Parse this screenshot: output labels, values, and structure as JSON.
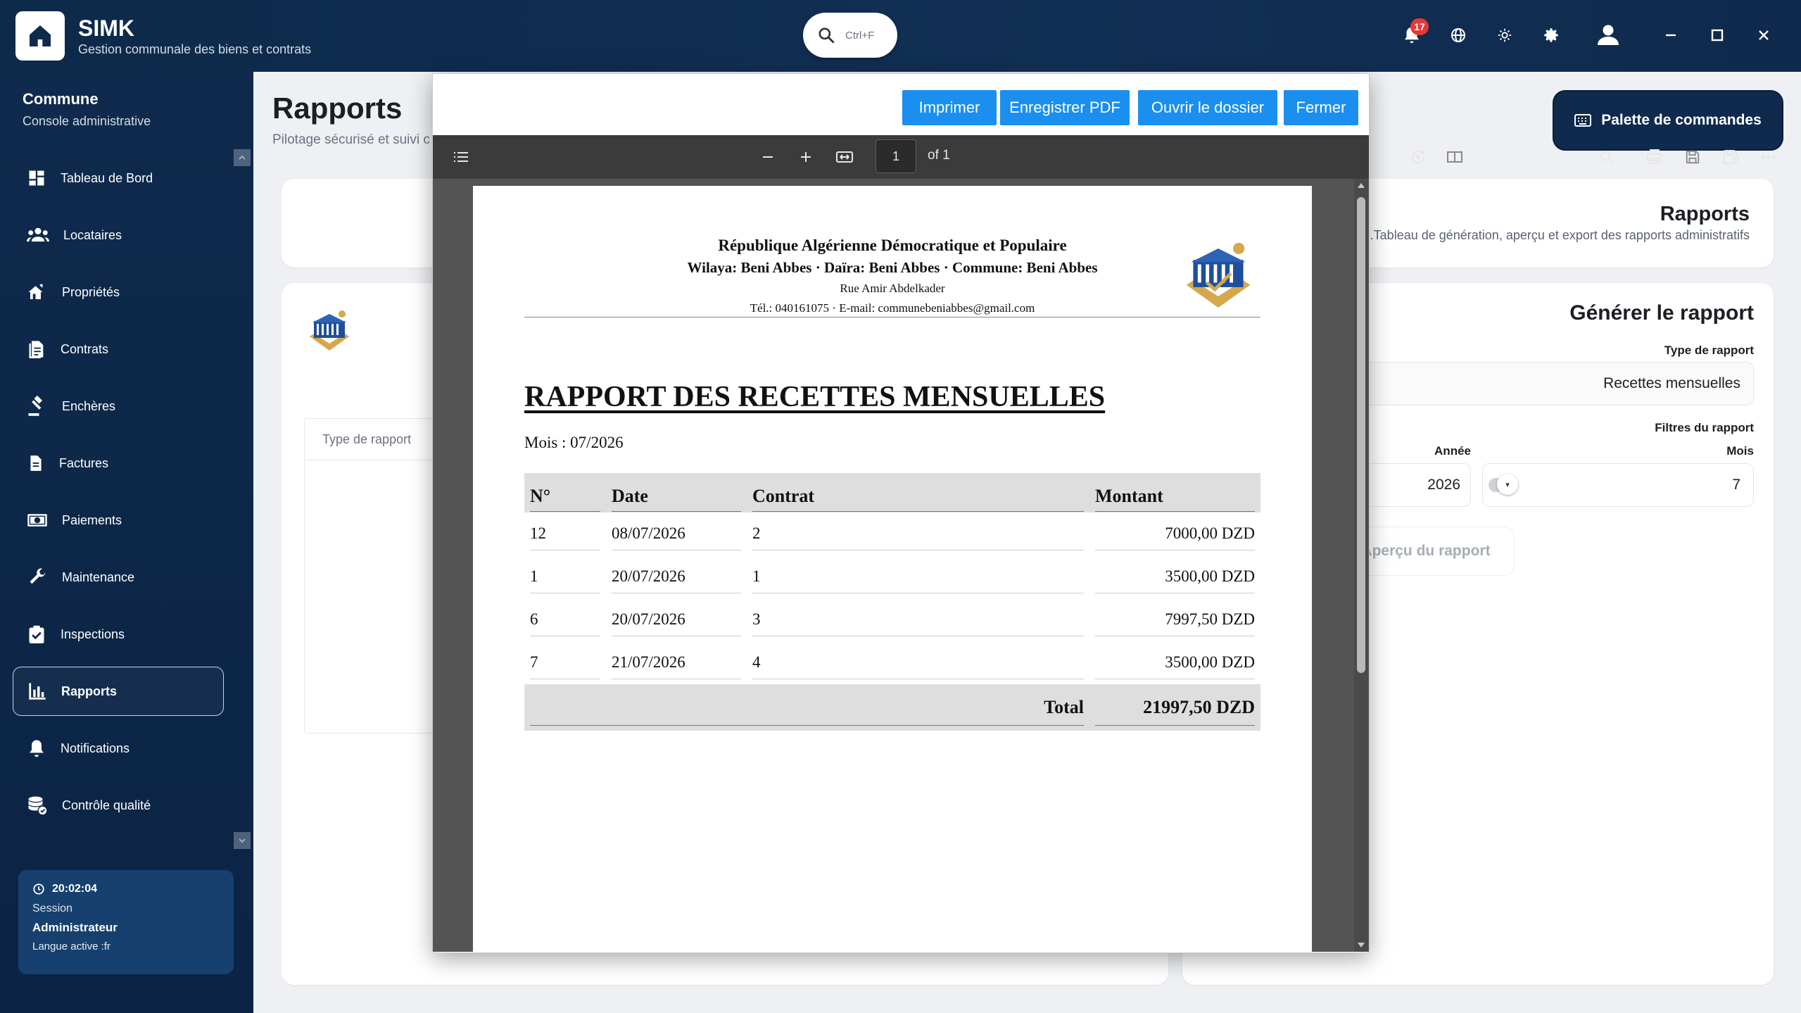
{
  "app": {
    "name": "SIMK",
    "subtitle": "Gestion communale des biens et contrats"
  },
  "search": {
    "shortcut": "Ctrl+F"
  },
  "topbar": {
    "notification_count": "17"
  },
  "sidebar": {
    "title": "Commune",
    "subtitle": "Console administrative",
    "items": [
      {
        "label": "Tableau de Bord",
        "icon": "dashboard-icon"
      },
      {
        "label": "Locataires",
        "icon": "people-icon"
      },
      {
        "label": "Propriétés",
        "icon": "property-icon"
      },
      {
        "label": "Contrats",
        "icon": "contract-icon"
      },
      {
        "label": "Enchères",
        "icon": "gavel-icon"
      },
      {
        "label": "Factures",
        "icon": "invoice-icon"
      },
      {
        "label": "Paiements",
        "icon": "payment-icon"
      },
      {
        "label": "Maintenance",
        "icon": "wrench-icon"
      },
      {
        "label": "Inspections",
        "icon": "checklist-icon"
      },
      {
        "label": "Rapports",
        "icon": "bar-chart-icon",
        "active": true
      },
      {
        "label": "Notifications",
        "icon": "bell-icon"
      },
      {
        "label": "Contrôle qualité",
        "icon": "database-icon"
      }
    ],
    "session": {
      "time": "20:02:04",
      "label": "Session",
      "user": "Administrateur",
      "language": "Langue active :fr"
    }
  },
  "page": {
    "title": "Rapports",
    "subtitle": "Pilotage sécurisé et suivi c",
    "command_palette": "Palette de commandes"
  },
  "left_panel": {
    "column_header": "Type de rapport"
  },
  "right_panel": {
    "header_title": "Rapports",
    "header_subtitle": ".Tableau de génération, aperçu et export des rapports administratifs",
    "generate_title": "Générer le rapport",
    "type_label": "Type de rapport",
    "type_value": "Recettes mensuelles",
    "filters_label": "Filtres du rapport",
    "year_label": "Année",
    "year_value": "2026",
    "month_label": "Mois",
    "month_value": "7",
    "preview_button": "Aperçu du rapport"
  },
  "modal": {
    "buttons": {
      "print": "Imprimer",
      "save_pdf": "Enregistrer PDF",
      "open_folder": "Ouvrir le dossier",
      "close": "Fermer"
    },
    "viewer": {
      "page": "1",
      "of": "of 1"
    }
  },
  "report": {
    "header_line1": "République Algérienne Démocratique et Populaire",
    "header_line2": "Wilaya: Beni Abbes · Daïra: Beni Abbes · Commune: Beni Abbes",
    "header_line3": "Rue Amir Abdelkader",
    "header_line4": "Tél.: 040161075 · E-mail: communebeniabbes@gmail.com",
    "title": "RAPPORT DES RECETTES MENSUELLES",
    "period": "Mois : 07/2026",
    "columns": [
      "N°",
      "Date",
      "Contrat",
      "Montant"
    ],
    "rows": [
      [
        "12",
        "08/07/2026",
        "2",
        "7000,00 DZD"
      ],
      [
        "1",
        "20/07/2026",
        "1",
        "3500,00 DZD"
      ],
      [
        "6",
        "20/07/2026",
        "3",
        "7997,50 DZD"
      ],
      [
        "7",
        "21/07/2026",
        "4",
        "3500,00 DZD"
      ]
    ],
    "total_label": "Total",
    "total_value": "21997,50 DZD"
  },
  "colors": {
    "topbar": "#122f55",
    "sidebar": "#0f2a4c",
    "accent_button": "#1a8fef",
    "pdf_toolbar": "#3b3b3b"
  }
}
